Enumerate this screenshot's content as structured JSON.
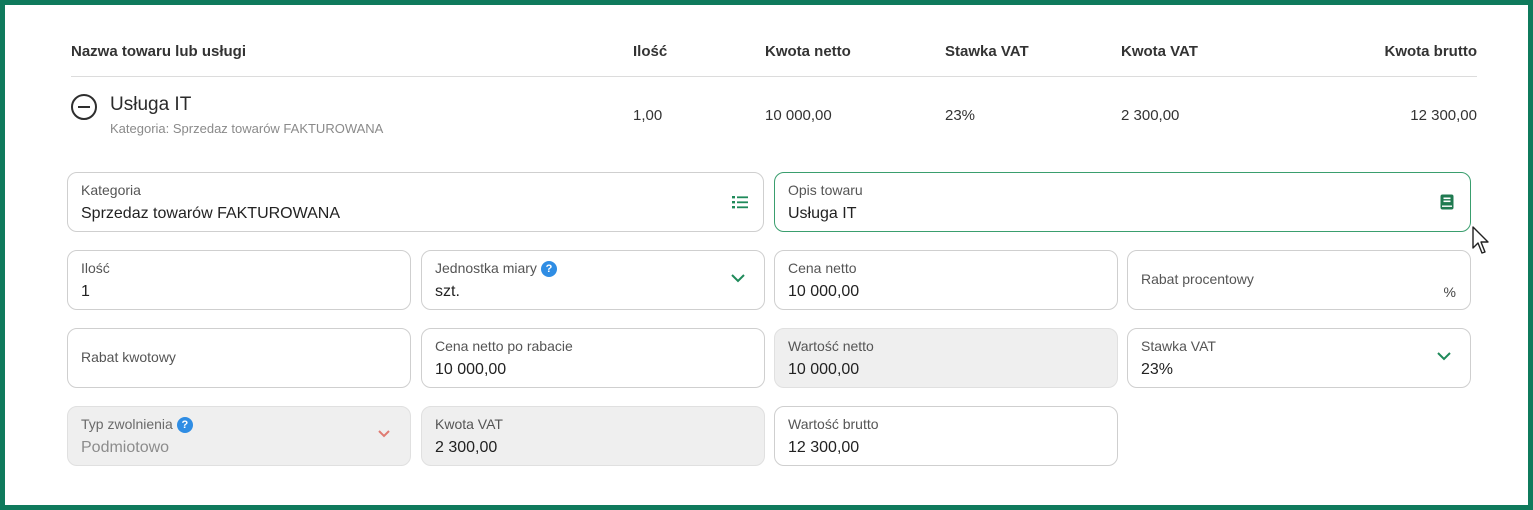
{
  "table": {
    "headers": {
      "name": "Nazwa towaru lub usługi",
      "qty": "Ilość",
      "net": "Kwota netto",
      "vat_rate": "Stawka VAT",
      "vat_amount": "Kwota VAT",
      "gross": "Kwota brutto"
    },
    "row": {
      "name": "Usługa IT",
      "category": "Kategoria: Sprzedaz towarów FAKTUROWANA",
      "qty": "1,00",
      "net": "10 000,00",
      "vat_rate": "23%",
      "vat_amount": "2 300,00",
      "gross": "12 300,00"
    }
  },
  "form": {
    "kategoria": {
      "label": "Kategoria",
      "value": "Sprzedaz towarów FAKTUROWANA",
      "icon": "list-icon"
    },
    "opis": {
      "label": "Opis towaru",
      "value": "Usługa IT",
      "icon": "book-icon"
    },
    "ilosc": {
      "label": "Ilość",
      "value": "1"
    },
    "jednostka": {
      "label": "Jednostka miary",
      "value": "szt."
    },
    "cena_netto": {
      "label": "Cena netto",
      "value": "10 000,00"
    },
    "rabat_procentowy": {
      "label": "Rabat procentowy",
      "suffix": "%"
    },
    "rabat_kwotowy": {
      "label": "Rabat kwotowy"
    },
    "cena_po_rabacie": {
      "label": "Cena netto po rabacie",
      "value": "10 000,00"
    },
    "wartosc_netto": {
      "label": "Wartość netto",
      "value": "10 000,00"
    },
    "stawka_vat": {
      "label": "Stawka VAT",
      "value": "23%"
    },
    "typ_zwolnienia": {
      "label": "Typ zwolnienia",
      "value": "Podmiotowo"
    },
    "kwota_vat": {
      "label": "Kwota VAT",
      "value": "2 300,00"
    },
    "wartosc_brutto": {
      "label": "Wartość brutto",
      "value": "12 300,00"
    }
  },
  "colors": {
    "frame": "#0f7a5c",
    "accent_green": "#3a9e6e",
    "help_blue": "#2f8de4",
    "chevron_red": "#e07b72"
  }
}
